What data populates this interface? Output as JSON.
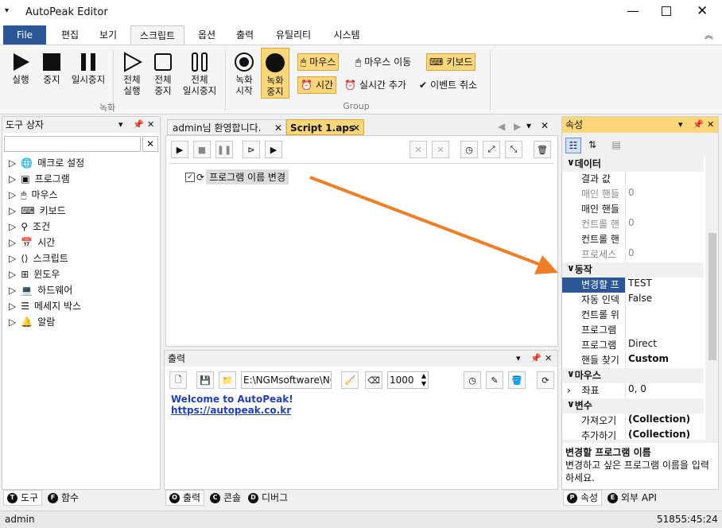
{
  "window": {
    "title": "AutoPeak Editor",
    "menu_icon": "chevron-down-icon"
  },
  "tabs": [
    {
      "label": "File"
    },
    {
      "label": "편집"
    },
    {
      "label": "보기"
    },
    {
      "label": "스크립트"
    },
    {
      "label": "옵션"
    },
    {
      "label": "출력"
    },
    {
      "label": "유틸리티"
    },
    {
      "label": "시스템"
    }
  ],
  "ribbon": {
    "run": "실행",
    "stop": "중지",
    "pause": "일시중지",
    "run_all_1": "전체",
    "run_all_2": "실행",
    "stop_all_1": "전체",
    "stop_all_2": "중지",
    "pause_all_1": "전체",
    "pause_all_2": "일시중지",
    "rec_start_1": "녹화",
    "rec_start_2": "시작",
    "rec_stop_1": "녹화",
    "rec_stop_2": "중지",
    "group1": "녹화",
    "group2": "Group",
    "mouse": "마우스",
    "mouse_move": "마우스 이동",
    "keyboard": "키보드",
    "time": "시간",
    "realtime_add": "실시간 추가",
    "event_cancel": "이벤트 취소"
  },
  "toolbox": {
    "title": "도구 상자",
    "search": "",
    "items": [
      "매크로 설정",
      "프로그램",
      "마우스",
      "키보드",
      "조건",
      "시간",
      "스크립트",
      "윈도우",
      "하드웨어",
      "메세지 박스",
      "알람"
    ],
    "bottom_tabs": [
      {
        "letter": "T",
        "label": "도구"
      },
      {
        "letter": "F",
        "label": "함수"
      }
    ]
  },
  "editor": {
    "tabs": [
      "admin님 환영합니다.",
      "Script 1.aps"
    ],
    "node": "프로그램 이름 변경"
  },
  "output": {
    "title": "출력",
    "path": "E:\\NGMsoftware\\NG",
    "count": "1000",
    "lines": [
      "Welcome to AutoPeak!",
      "https://autopeak.co.kr"
    ],
    "bottom_tabs": [
      {
        "letter": "O",
        "label": "출력"
      },
      {
        "letter": "C",
        "label": "콘솔"
      },
      {
        "letter": "D",
        "label": "디버그"
      }
    ]
  },
  "properties": {
    "title": "속성",
    "sections": [
      {
        "name": "데이터",
        "rows": [
          [
            "결과 값",
            ""
          ],
          [
            "매인 핸들",
            "0"
          ],
          [
            "매인 핸들",
            ""
          ],
          [
            "컨트롤 핸",
            "0"
          ],
          [
            "컨트롤 핸",
            ""
          ],
          [
            "프로세스 ",
            "0"
          ]
        ]
      },
      {
        "name": "동작",
        "rows": [
          [
            "변경할 프",
            "TEST"
          ],
          [
            "자동 인덱",
            "False"
          ],
          [
            "컨트롤 위",
            ""
          ],
          [
            "프로그램 ",
            ""
          ],
          [
            "프로그램 ",
            "Direct"
          ],
          [
            "핸들 찾기",
            "Custom"
          ]
        ]
      },
      {
        "name": "마우스",
        "rows": [
          [
            "좌표",
            "0, 0"
          ]
        ]
      },
      {
        "name": "변수",
        "rows": [
          [
            "가져오기",
            "(Collection)"
          ],
          [
            "추가하기",
            "(Collection)"
          ]
        ]
      }
    ],
    "desc_title": "변경할 프로그램 이름",
    "desc_text": "변경하고 싶은 프로그램 이름을 입력하세요.",
    "bottom_tabs": [
      {
        "letter": "P",
        "label": "속성"
      },
      {
        "letter": "E",
        "label": "외부 API"
      }
    ]
  },
  "status": {
    "user": "admin",
    "time": "51855:45:24"
  },
  "colors": {
    "accent": "#2b5797",
    "highlight": "#fbd77a",
    "arrow": "#f07e24",
    "link": "#1f3fc0"
  }
}
